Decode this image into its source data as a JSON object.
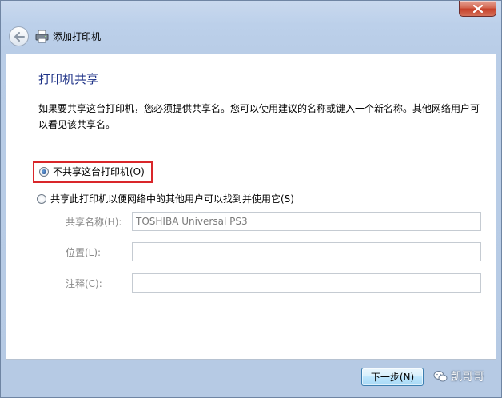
{
  "window": {
    "header_title": "添加打印机"
  },
  "icons": {
    "close": "close-icon",
    "back": "back-arrow-icon",
    "printer": "printer-icon",
    "watermark": "wechat-icon"
  },
  "page": {
    "title": "打印机共享",
    "description": "如果要共享这台打印机，您必须提供共享名。您可以使用建议的名称或键入一个新名称。其他网络用户可以看见该共享名。"
  },
  "options": [
    {
      "label": "不共享这台打印机(O)",
      "selected": true
    },
    {
      "label": "共享此打印机以便网络中的其他用户可以找到并使用它(S)",
      "selected": false
    }
  ],
  "fields": [
    {
      "label": "共享名称(H):",
      "value": "TOSHIBA Universal PS3"
    },
    {
      "label": "位置(L):",
      "value": ""
    },
    {
      "label": "注释(C):",
      "value": ""
    }
  ],
  "buttons": {
    "next": "下一步(N)"
  },
  "watermark": {
    "text": "凱哥哥"
  },
  "colors": {
    "title_blue": "#1e3287",
    "highlight_red": "#d9262a",
    "close_red": "#c6412a"
  }
}
